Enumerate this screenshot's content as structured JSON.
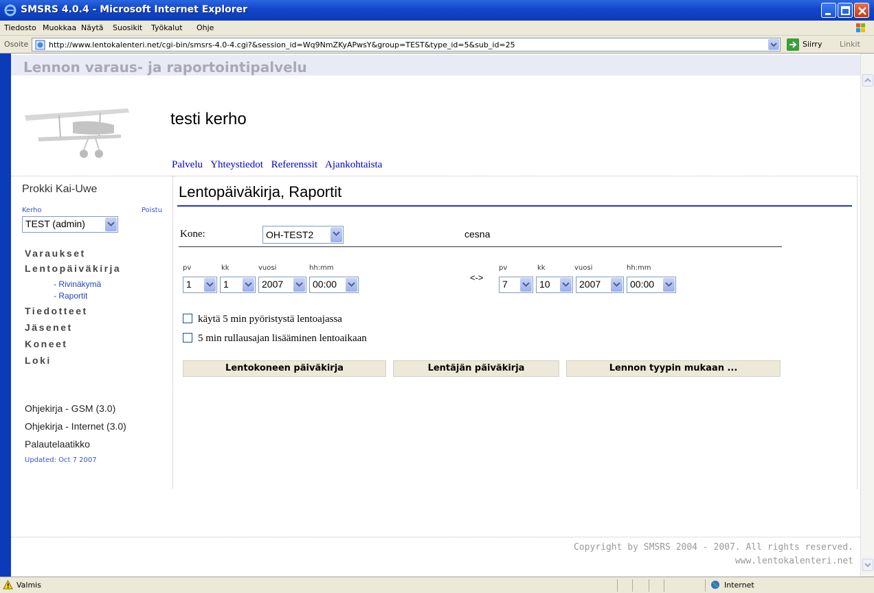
{
  "window": {
    "title": "SMSRS 4.0.4 - Microsoft Internet Explorer"
  },
  "menu": [
    "Tiedosto",
    "Muokkaa",
    "Näytä",
    "Suosikit",
    "Työkalut",
    "Ohje"
  ],
  "address": {
    "label": "Osoite",
    "url": "http://www.lentokalenteri.net/cgi-bin/smsrs-4.0-4.cgi?&session_id=Wq9NmZKyAPwsY&group=TEST&type_id=5&sub_id=25",
    "go": "Siirry",
    "links": "Linkit"
  },
  "site": {
    "title": "Lennon varaus- ja raportointipalvelu",
    "club": "testi kerho",
    "nav": [
      "Palvelu",
      "Yhteystiedot",
      "Referenssit",
      "Ajankohtaista"
    ]
  },
  "sidebar": {
    "user": "Prokki Kai-Uwe",
    "kerho_label": "Kerho",
    "logout": "Poistu",
    "club_select": "TEST (admin)",
    "items": [
      "Varaukset",
      "Lentopäiväkirja",
      "Tiedotteet",
      "Jäsenet",
      "Koneet",
      "Loki"
    ],
    "subitems": [
      "- Rivinäkymä",
      "- Raportit"
    ],
    "help": [
      "Ohjekirja - GSM (3.0)",
      "Ohjekirja - Internet (3.0)",
      "Palautelaatikko"
    ],
    "updated": "Updated: Oct 7 2007"
  },
  "main": {
    "title": "Lentopäiväkirja, Raportit",
    "kone_label": "Kone:",
    "kone_value": "OH-TEST2",
    "kone_desc": "cesna",
    "col_labels": {
      "pv": "pv",
      "kk": "kk",
      "vuosi": "vuosi",
      "time": "hh:mm"
    },
    "from": {
      "pv": "1",
      "kk": "1",
      "vuosi": "2007",
      "time": "00:00"
    },
    "separator": "<->",
    "to": {
      "pv": "7",
      "kk": "10",
      "vuosi": "2007",
      "time": "00:00"
    },
    "checkbox1": "käytä 5 min pyöristystä lentoajassa",
    "checkbox2": "5 min rullausajan lisääminen lentoaikaan",
    "buttons": [
      "Lentokoneen päiväkirja",
      "Lentäjän päiväkirja",
      "Lennon tyypin mukaan ..."
    ]
  },
  "footer": {
    "copyright": "Copyright by SMSRS 2004 - 2007. All rights reserved.",
    "site": "www.lentokalenteri.net"
  },
  "status": {
    "text": "Valmis",
    "zone": "Internet"
  }
}
